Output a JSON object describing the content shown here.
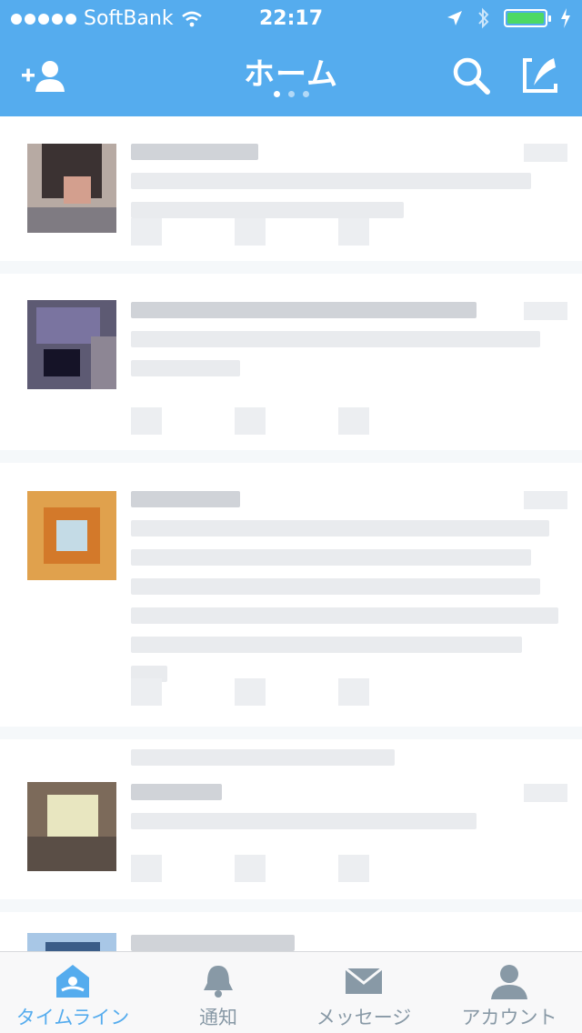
{
  "status_bar": {
    "carrier": "SoftBank",
    "time": "22:17"
  },
  "header": {
    "title": "ホーム",
    "pager_pages": 3,
    "pager_active": 1
  },
  "icons": {
    "add_user": "add-user-icon",
    "search": "search-icon",
    "compose": "compose-icon"
  },
  "colors": {
    "brand": "#55acee",
    "inactive": "#8899a6",
    "battery": "#4cd964"
  },
  "tabbar": {
    "items": [
      {
        "label": "タイムライン",
        "icon": "home-icon",
        "active": true
      },
      {
        "label": "通知",
        "icon": "bell-icon",
        "active": false
      },
      {
        "label": "メッセージ",
        "icon": "envelope-icon",
        "active": false
      },
      {
        "label": "アカウント",
        "icon": "person-icon",
        "active": false
      }
    ]
  }
}
